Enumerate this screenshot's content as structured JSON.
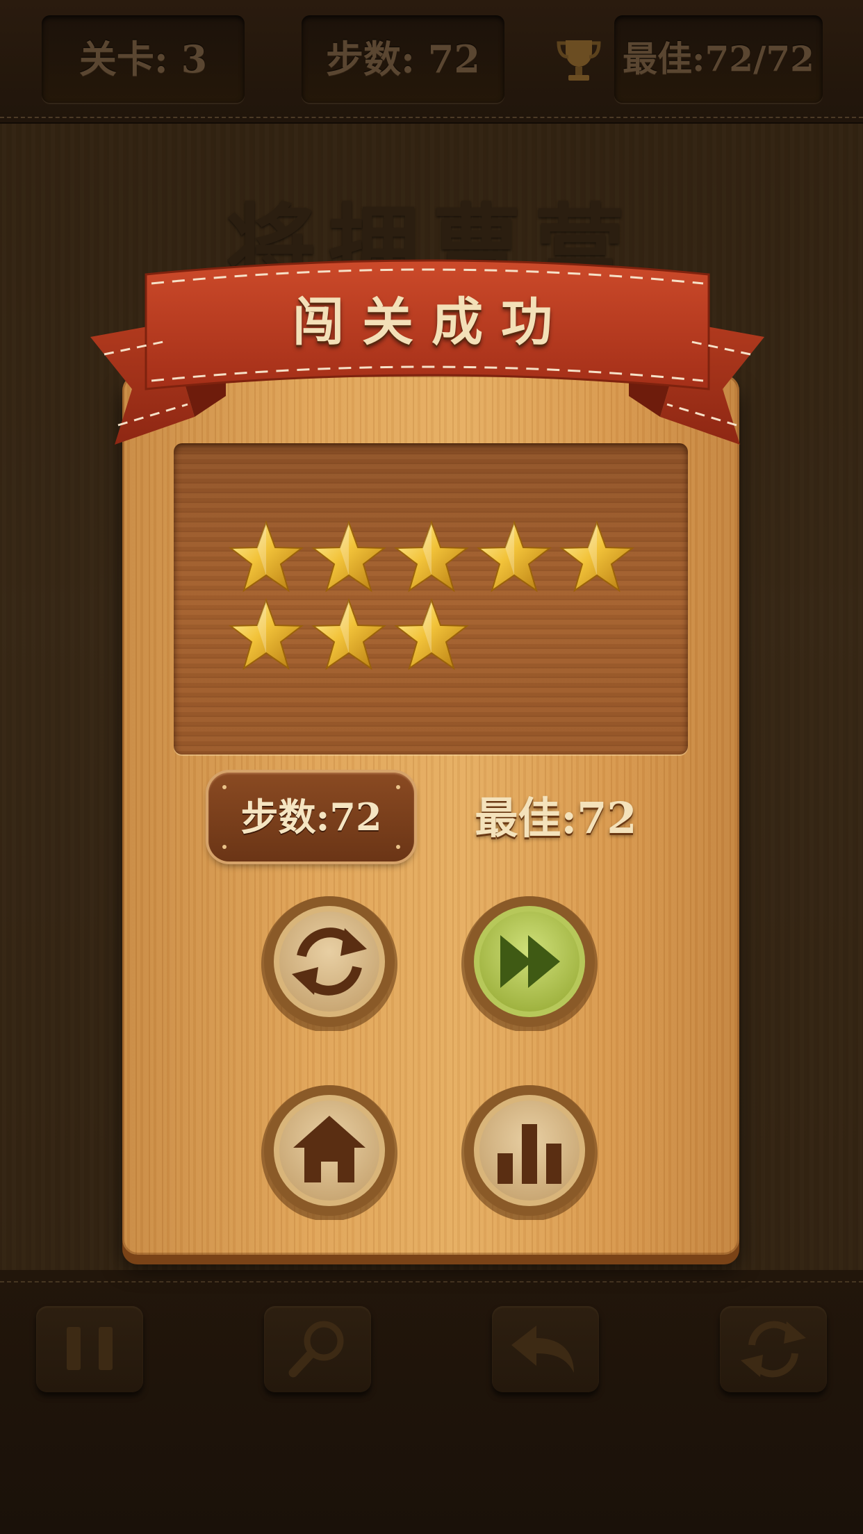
{
  "header": {
    "level_text": "关卡: 3",
    "steps_text": "步数: 72",
    "best_text": "最佳:72/72",
    "trophy_icon": "trophy-icon"
  },
  "background_title": "将拥曹营",
  "dialog": {
    "title": "闯关成功",
    "stars_earned": 8,
    "steps_label": "步数:72",
    "best_label": "最佳:72",
    "buttons": {
      "replay_icon": "replay-icon",
      "next_icon": "play-next-icon",
      "home_icon": "home-icon",
      "leaderboard_icon": "bar-chart-icon"
    }
  },
  "toolbar": {
    "items": [
      "pause-icon",
      "search-icon",
      "undo-icon",
      "refresh-icon"
    ]
  },
  "colors": {
    "ribbon_red": "#b8371e",
    "panel_wood": "#e0a458",
    "star_gold": "#f2c33a",
    "next_button_green": "#a6b64a"
  }
}
